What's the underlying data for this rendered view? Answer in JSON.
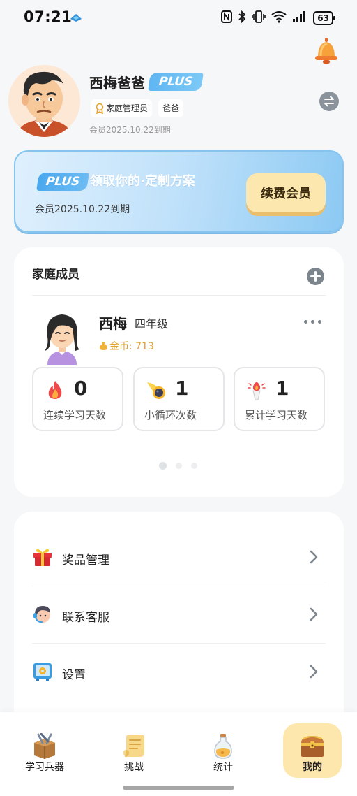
{
  "status_bar": {
    "time": "07:21",
    "battery": "63",
    "icons": [
      "nfc-icon",
      "bluetooth-icon",
      "vibrate-icon",
      "wifi-icon",
      "signal-icon",
      "battery-icon"
    ]
  },
  "profile": {
    "name": "西梅爸爸",
    "plus_badge": "PLUS",
    "role": "家庭管理员",
    "relation": "爸爸",
    "membership_expiry": "会员2025.10.22到期"
  },
  "banner": {
    "plus_badge": "PLUS",
    "slogan": "领取你的·定制方案",
    "expiry": "会员2025.10.22到期",
    "renew_button": "续费会员"
  },
  "family": {
    "title": "家庭成员",
    "member": {
      "name": "西梅",
      "grade": "四年级",
      "coins": "金币: 713"
    },
    "stats": [
      {
        "value": "0",
        "label": "连续学习天数",
        "icon": "flame-icon"
      },
      {
        "value": "1",
        "label": "小循环次数",
        "icon": "meteor-icon"
      },
      {
        "value": "1",
        "label": "累计学习天数",
        "icon": "torch-icon"
      }
    ],
    "page_count": 3,
    "active_page": 1
  },
  "menu": {
    "items": [
      {
        "label": "奖品管理",
        "icon": "gift-icon"
      },
      {
        "label": "联系客服",
        "icon": "customer-service-icon"
      },
      {
        "label": "设置",
        "icon": "settings-icon"
      }
    ]
  },
  "tabs": [
    {
      "label": "学习兵器",
      "icon": "weapon-box-icon",
      "active": false
    },
    {
      "label": "挑战",
      "icon": "scroll-icon",
      "active": false
    },
    {
      "label": "统计",
      "icon": "potion-icon",
      "active": false
    },
    {
      "label": "我的",
      "icon": "treasure-chest-icon",
      "active": true
    }
  ],
  "colors": {
    "accent_blue": "#6dbcf3",
    "renew_button": "#fce7ae",
    "active_tab": "#fde7ad",
    "coin_text": "#e3a02c",
    "background": "#f6f7f8"
  }
}
